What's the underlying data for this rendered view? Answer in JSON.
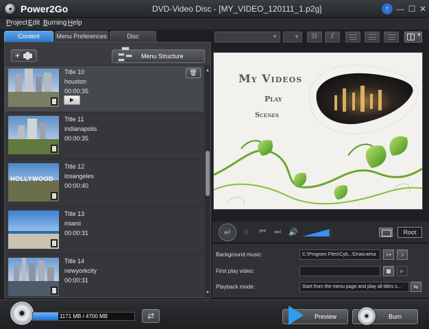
{
  "app": {
    "name": "Power2Go",
    "window_title": "DVD-Video Disc - [MY_VIDEO_120111_1.p2g]"
  },
  "titlebar": {
    "update_symbol": "↑",
    "minimize": "—",
    "maximize": "☐",
    "close": "✕"
  },
  "menu": [
    "Project",
    "Edit",
    "Burning",
    "Help"
  ],
  "tabs": [
    {
      "label": "Content",
      "active": true
    },
    {
      "label": "Menu Preferences",
      "active": false
    },
    {
      "label": "Disc Preferences",
      "active": false
    }
  ],
  "toolbar": {
    "add_symbol": "+",
    "menu_structure": "Menu Structure"
  },
  "titles": [
    {
      "title": "Title 10",
      "name": "houston",
      "duration": "00:00:35",
      "selected": true
    },
    {
      "title": "Title 11",
      "name": "indianapolis",
      "duration": "00:00:35",
      "selected": false
    },
    {
      "title": "Title 12",
      "name": "losangeles",
      "duration": "00:00:40",
      "selected": false
    },
    {
      "title": "Title 13",
      "name": "miami",
      "duration": "00:00:31",
      "selected": false
    },
    {
      "title": "Title 14",
      "name": "newyorkcity",
      "duration": "00:00:31",
      "selected": false
    }
  ],
  "thumb_text": {
    "hollywood": "HOLLYWOOD"
  },
  "item_controls": {
    "play_symbol": "▶",
    "delete_symbol": "🗑"
  },
  "format_bar": {
    "bold": "B",
    "italic": "I"
  },
  "preview_menu": {
    "title": "My Videos",
    "play": "Play",
    "scenes": "Scenes"
  },
  "transport": {
    "back_symbol": "↵",
    "home_symbol": "⌂",
    "prev_symbol": "⏮",
    "next_symbol": "⏭",
    "volume_symbol": "🔊",
    "root_label": "Root",
    "volume_level": 0.9
  },
  "settings": {
    "background_music_label": "Background music:",
    "background_music_value": "C:\\Program Files\\Cyb...\\Draw.wma",
    "first_play_label": "First play video:",
    "first_play_value": "",
    "playback_mode_label": "Playback mode:",
    "playback_mode_value": "Start from the menu page and play all titles s..."
  },
  "bottom": {
    "capacity_text": "1171 MB / 4700 MB",
    "capacity_fraction": 0.249,
    "swap_symbol": "⇄",
    "preview_label": "Preview",
    "burn_label": "Burn"
  },
  "colors": {
    "accent": "#2d78c9",
    "capacity_fill": "#3c8ef0",
    "preview_arrow": "#2f9df0",
    "vine_green": "#6aa82a"
  }
}
